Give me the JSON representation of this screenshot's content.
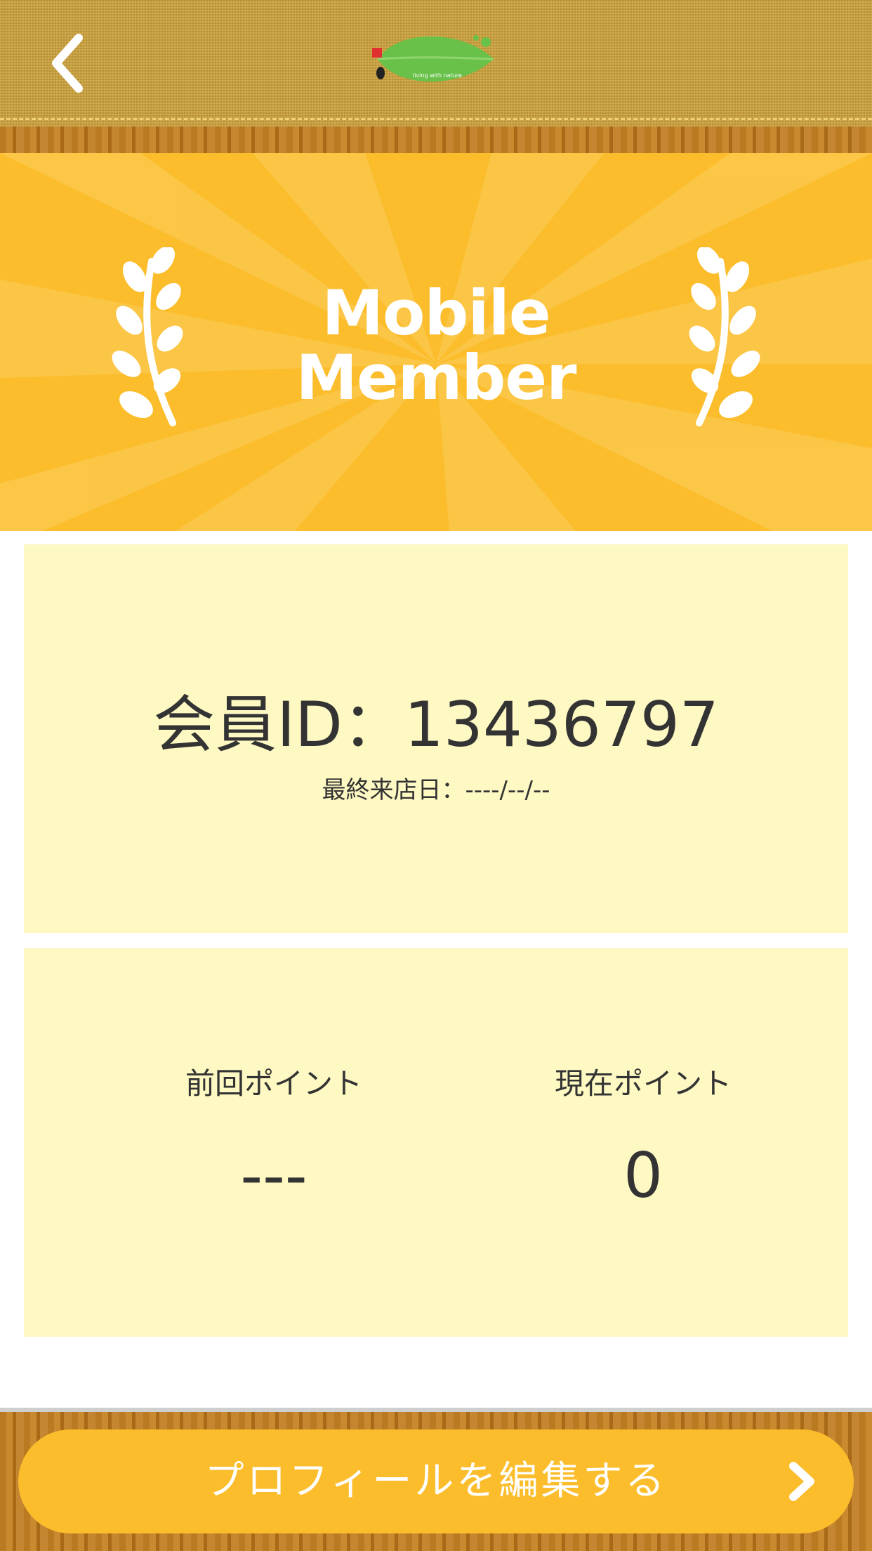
{
  "header": {
    "back_icon": "chevron-left-icon",
    "logo": "leaf-logo",
    "logo_tagline": "living with nature"
  },
  "banner": {
    "title_line1": "Mobile",
    "title_line2": "Member",
    "laurel_icon": "laurel-icon"
  },
  "member_card": {
    "member_id": "会員ID：13436797",
    "last_visit": "最終来店日：----/--/--"
  },
  "points": {
    "previous_label": "前回ポイント",
    "previous_value": "---",
    "current_label": "現在ポイント",
    "current_value": "0"
  },
  "footer": {
    "edit_profile_label": "プロフィールを編集する",
    "chevron_icon": "chevron-right-icon"
  },
  "colors": {
    "banner": "#fbbd2c",
    "card": "#fef8c3",
    "text": "#333333",
    "button": "#fbbd2c"
  }
}
